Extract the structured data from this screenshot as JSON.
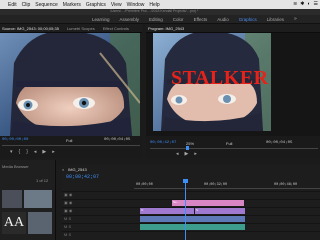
{
  "menubar": {
    "apple": "",
    "items": [
      "Edit",
      "Clip",
      "Sequence",
      "Markers",
      "Graphics",
      "View",
      "Window",
      "Help"
    ],
    "right": [
      "≋",
      "✱",
      "◐",
      "☰"
    ]
  },
  "workspaces": {
    "path": "/Users/…/Premiere Pro/…/2018 Kendall Projects/…proj *",
    "items": [
      "Learning",
      "Assembly",
      "Editing",
      "Color",
      "Effects",
      "Audio",
      "Graphics",
      "Libraries"
    ],
    "active": "Graphics",
    "more": "»"
  },
  "source_panel": {
    "tabs": [
      "Source: IMG_2543: 00;00;05;35",
      "Lumetri Scopes",
      "Effect Controls"
    ],
    "timecode": "00;00;00;00",
    "fit": "Full",
    "duration": "00;00;04;05"
  },
  "program_panel": {
    "tab": "Program: IMG_2543",
    "overlay_text": "STALKER",
    "timecode": "00;00;42;07",
    "zoom": "25%",
    "fit": "Full",
    "duration": "00;00;04;05"
  },
  "project_panel": {
    "tab": "Media Browser",
    "count": "1 of 12",
    "thumb_text": "AA"
  },
  "timeline": {
    "tab": "IMG_2543",
    "close": "×",
    "timecode": "00;00;42;07",
    "ruler": [
      "00;00;00",
      "00;00;32;00",
      "00;00;48;00"
    ],
    "clip_labels": [
      "Ne…",
      "fx",
      "fx"
    ]
  },
  "colors": {
    "accent": "#3e8ef7",
    "title_red": "#e6231a",
    "clip_pink": "#d986c5",
    "clip_purple": "#a07ad1"
  }
}
